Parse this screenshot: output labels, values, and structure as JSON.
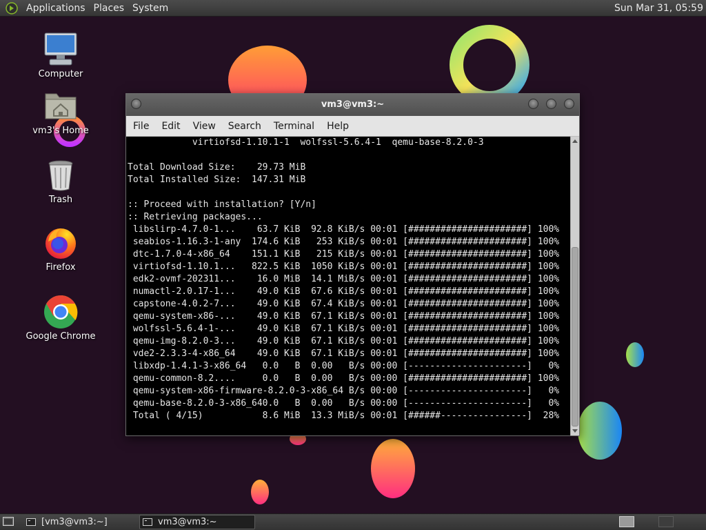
{
  "top_panel": {
    "menus": [
      "Applications",
      "Places",
      "System"
    ],
    "clock": "Sun Mar 31, 05:59"
  },
  "desktop": {
    "icons": [
      {
        "label": "Computer",
        "icon": "computer-icon"
      },
      {
        "label": "vm3's Home",
        "icon": "home-folder-icon"
      },
      {
        "label": "Trash",
        "icon": "trash-icon"
      },
      {
        "label": "Firefox",
        "icon": "firefox-icon"
      },
      {
        "label": "Google Chrome",
        "icon": "chrome-icon"
      }
    ]
  },
  "window": {
    "title": "vm3@vm3:~",
    "menu": [
      "File",
      "Edit",
      "View",
      "Search",
      "Terminal",
      "Help"
    ],
    "terminal_lines": [
      "            virtiofsd-1.10.1-1  wolfssl-5.6.4-1  qemu-base-8.2.0-3",
      "",
      "Total Download Size:    29.73 MiB",
      "Total Installed Size:  147.31 MiB",
      "",
      ":: Proceed with installation? [Y/n]",
      ":: Retrieving packages...",
      " libslirp-4.7.0-1...    63.7 KiB  92.8 KiB/s 00:01 [######################] 100%",
      " seabios-1.16.3-1-any  174.6 KiB   253 KiB/s 00:01 [######################] 100%",
      " dtc-1.7.0-4-x86_64    151.1 KiB   215 KiB/s 00:01 [######################] 100%",
      " virtiofsd-1.10.1...   822.5 KiB  1050 KiB/s 00:01 [######################] 100%",
      " edk2-ovmf-202311...    16.0 MiB  14.1 MiB/s 00:01 [######################] 100%",
      " numactl-2.0.17-1...    49.0 KiB  67.6 KiB/s 00:01 [######################] 100%",
      " capstone-4.0.2-7...    49.0 KiB  67.4 KiB/s 00:01 [######################] 100%",
      " qemu-system-x86-...    49.0 KiB  67.1 KiB/s 00:01 [######################] 100%",
      " wolfssl-5.6.4-1-...    49.0 KiB  67.1 KiB/s 00:01 [######################] 100%",
      " qemu-img-8.2.0-3...    49.0 KiB  67.1 KiB/s 00:01 [######################] 100%",
      " vde2-2.3.3-4-x86_64    49.0 KiB  67.1 KiB/s 00:01 [######################] 100%",
      " libxdp-1.4.1-3-x86_64   0.0   B  0.00   B/s 00:00 [----------------------]   0%",
      " qemu-common-8.2....     0.0   B  0.00   B/s 00:00 [######################] 100%",
      " qemu-system-x86-firmware-8.2.0-3-x86_64 B/s 00:00 [----------------------]   0%",
      " qemu-base-8.2.0-3-x86_640.0   B  0.00   B/s 00:00 [----------------------]   0%",
      " Total ( 4/15)           8.6 MiB  13.3 MiB/s 00:01 [######----------------]  28%"
    ]
  },
  "taskbar": {
    "tasks": [
      "[vm3@vm3:~]",
      "vm3@vm3:~"
    ]
  },
  "colors": {
    "wallpaper": "#230f22",
    "terminal_bg": "#000000",
    "terminal_fg": "#e6e6e6"
  }
}
